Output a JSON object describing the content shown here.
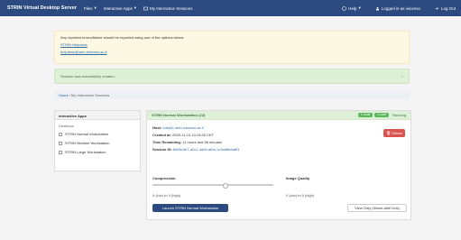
{
  "navbar": {
    "brand": "STRIN Virtual Desktop Server",
    "files_label": "Files",
    "interactive_apps_label": "Interactive Apps",
    "my_sessions_label": "My Interactive Sessions",
    "help_label": "Help",
    "logged_in_label": "Logged in as ivicenso",
    "logout_label": "Log Out"
  },
  "alert_warning": {
    "line1": "Any reported errors/failure should be reported using one of the options below:",
    "link1": "STRIN Helpdesk",
    "link2": "helpdesk@strin.ivicenso.ac.il"
  },
  "alert_success": {
    "message": "Session was successfully created.",
    "close": "×"
  },
  "breadcrumb": {
    "home": "Home",
    "separator": "/",
    "current": "My Interactive Sessions"
  },
  "left_panel": {
    "header": "Interactive Apps",
    "section": "Desktops",
    "items": [
      {
        "label": "STRIN Normal Workstation"
      },
      {
        "label": "STRIN Medium Workstation"
      },
      {
        "label": "STRIN Large Workstation"
      }
    ]
  },
  "session": {
    "title": "STRIN Normal Workstation (22)",
    "badge1": "1 node",
    "badge2": "1 core",
    "status": "Running",
    "host_label": "Host:",
    "host_value": "vdesk1.strin.ivicenso.ac.il",
    "created_label": "Created at:",
    "created_value": "2020-11-10 13:15:26 CET",
    "time_label": "Time Remaining:",
    "time_value": "11 hours and 58 minutes",
    "session_label": "Session ID:",
    "session_value": "8d55c3e7-a2c1-4a2b-af4a-1c3ad6b6a8f1",
    "delete_label": "Delete",
    "compression_title": "Compression",
    "compression_note": "0 (low) to 9 (high)",
    "compression_value": 0.6,
    "quality_title": "Image Quality",
    "quality_note": "0 (low) to 9 (high)",
    "launch_label": "Launch STRIN Normal Workstation",
    "viewonly_label": "View Only (Share-able Link)"
  }
}
